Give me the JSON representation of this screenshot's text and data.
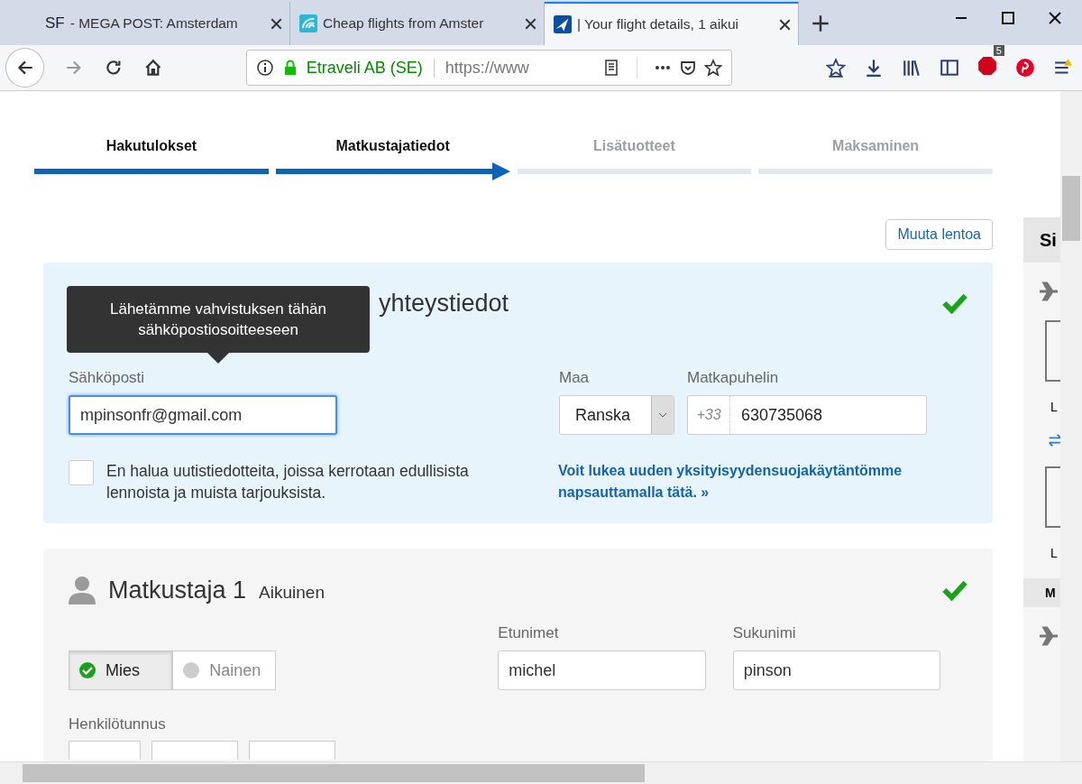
{
  "browser": {
    "tabs": [
      {
        "label": "- MEGA POST: Amsterdam",
        "icon_text": "SF",
        "selected": false
      },
      {
        "label": "Cheap flights from Amster",
        "selected": false
      },
      {
        "label": "| Your flight details, 1 aikui",
        "selected": true
      }
    ],
    "site_identity": "Etraveli AB (SE)",
    "url": "https://www",
    "addon_badge": "5"
  },
  "steps": [
    {
      "label": "Hakutulokset",
      "done": true,
      "current": false
    },
    {
      "label": "Matkustajatiedot",
      "done": true,
      "current": true
    },
    {
      "label": "Lisätuotteet",
      "done": false,
      "current": false
    },
    {
      "label": "Maksaminen",
      "done": false,
      "current": false
    }
  ],
  "change_flight_button": "Muuta lentoa",
  "contact": {
    "heading": "yhteystiedot",
    "complete": true,
    "tooltip": "Lähetämme vahvistuksen tähän sähköpostiosoitteeseen",
    "email_label": "Sähköposti",
    "email": "mpinsonfr@gmail.com",
    "country_label": "Maa",
    "country": "Ranska",
    "phone_label": "Matkapuhelin",
    "phone_prefix": "+33",
    "phone": "630735068",
    "newsletter": {
      "label": "En halua uutistiedotteita, joissa kerrotaan edullisista lennoista ja muista tarjouksista.",
      "checked": false
    },
    "privacy_link": "Voit lukea uuden yksityisyydensuojakäytäntömme napsauttamalla tätä. »"
  },
  "traveler": {
    "title": "Matkustaja 1",
    "type": "Aikuinen",
    "complete": true,
    "genders": [
      {
        "label": "Mies",
        "selected": true
      },
      {
        "label": "Nainen",
        "selected": false
      }
    ],
    "first_name_label": "Etunimet",
    "first_name": "michel",
    "last_name_label": "Sukunimi",
    "last_name": "pinson",
    "id_label": "Henkilötunnus"
  },
  "sidebar": {
    "title": "Si",
    "texts": [
      "L",
      "L",
      "M"
    ]
  }
}
